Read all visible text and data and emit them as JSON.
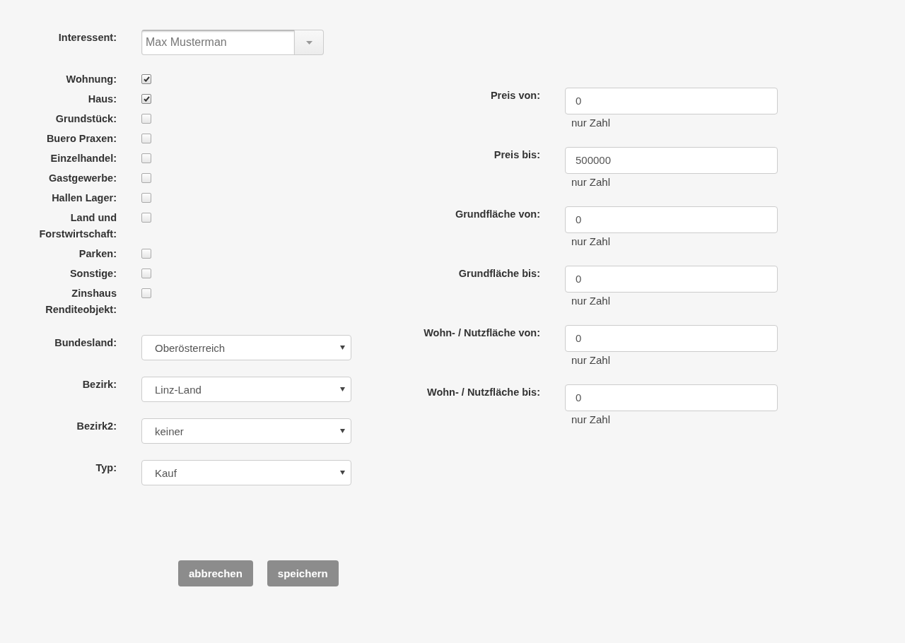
{
  "interessent": {
    "label": "Interessent:",
    "value": "Max Musterman"
  },
  "property_types": [
    {
      "label": "Wohnung:",
      "checked": true
    },
    {
      "label": "Haus:",
      "checked": true
    },
    {
      "label": "Grundstück:",
      "checked": false
    },
    {
      "label": "Buero Praxen:",
      "checked": false
    },
    {
      "label": "Einzelhandel:",
      "checked": false
    },
    {
      "label": "Gastgewerbe:",
      "checked": false
    },
    {
      "label": "Hallen Lager:",
      "checked": false
    },
    {
      "label": "Land und Forstwirtschaft:",
      "checked": false
    },
    {
      "label": "Parken:",
      "checked": false
    },
    {
      "label": "Sonstige:",
      "checked": false
    },
    {
      "label": "Zinshaus Renditeobjekt:",
      "checked": false
    }
  ],
  "selects": [
    {
      "label": "Bundesland:",
      "value": "Oberösterreich"
    },
    {
      "label": "Bezirk:",
      "value": "Linz-Land"
    },
    {
      "label": "Bezirk2:",
      "value": "keiner"
    },
    {
      "label": "Typ:",
      "value": "Kauf"
    }
  ],
  "ranges": [
    {
      "label": "Preis von:",
      "value": "0",
      "hint": "nur Zahl"
    },
    {
      "label": "Preis bis:",
      "value": "500000",
      "hint": "nur Zahl"
    },
    {
      "label": "Grundfläche von:",
      "value": "0",
      "hint": "nur Zahl"
    },
    {
      "label": "Grundfläche bis:",
      "value": "0",
      "hint": "nur Zahl"
    },
    {
      "label": "Wohn- / Nutzfläche von:",
      "value": "0",
      "hint": "nur Zahl"
    },
    {
      "label": "Wohn- / Nutzfläche bis:",
      "value": "0",
      "hint": "nur Zahl"
    }
  ],
  "buttons": [
    {
      "label": "abbrechen"
    },
    {
      "label": "speichern"
    }
  ]
}
